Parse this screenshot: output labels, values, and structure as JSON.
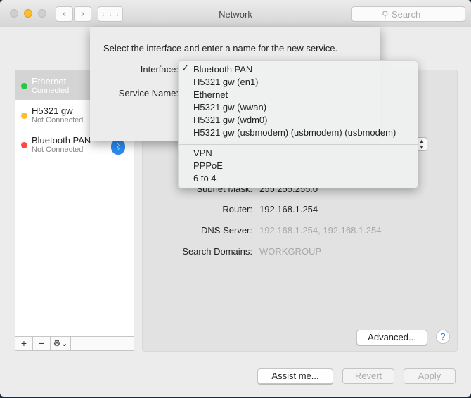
{
  "window": {
    "title": "Network",
    "search_placeholder": "Search"
  },
  "sidebar": {
    "services": [
      {
        "name": "Ethernet",
        "status": "Connected",
        "color": "#28c840",
        "selected": true
      },
      {
        "name": "H5321 gw",
        "status": "Not Connected",
        "color": "#febc2e"
      },
      {
        "name": "Bluetooth PAN",
        "status": "Not Connected",
        "color": "#ff4a44",
        "icon": "bluetooth-icon"
      }
    ],
    "add": "+",
    "remove": "−",
    "gear": "⚙⌄"
  },
  "details": {
    "subnet_label": "Subnet Mask:",
    "subnet_value": "255.255.255.0",
    "router_label": "Router:",
    "router_value": "192.168.1.254",
    "dns_label": "DNS Server:",
    "dns_value": "192.168.1.254, 192.168.1.254",
    "domains_label": "Search Domains:",
    "domains_value": "WORKGROUP",
    "advanced": "Advanced...",
    "help": "?"
  },
  "footer": {
    "assist": "Assist me...",
    "revert": "Revert",
    "apply": "Apply"
  },
  "sheet": {
    "message": "Select the interface and enter a name for the new service.",
    "interface_label": "Interface:",
    "service_name_label": "Service Name:"
  },
  "menu": {
    "checkmark": "✓",
    "items": [
      "Bluetooth PAN",
      "H5321 gw (en1)",
      "Ethernet",
      "H5321 gw (wwan)",
      "H5321 gw (wdm0)",
      "H5321 gw (usbmodem) (usbmodem) (usbmodem)"
    ],
    "items2": [
      "VPN",
      "PPPoE",
      "6 to 4"
    ],
    "selected": "Bluetooth PAN"
  }
}
